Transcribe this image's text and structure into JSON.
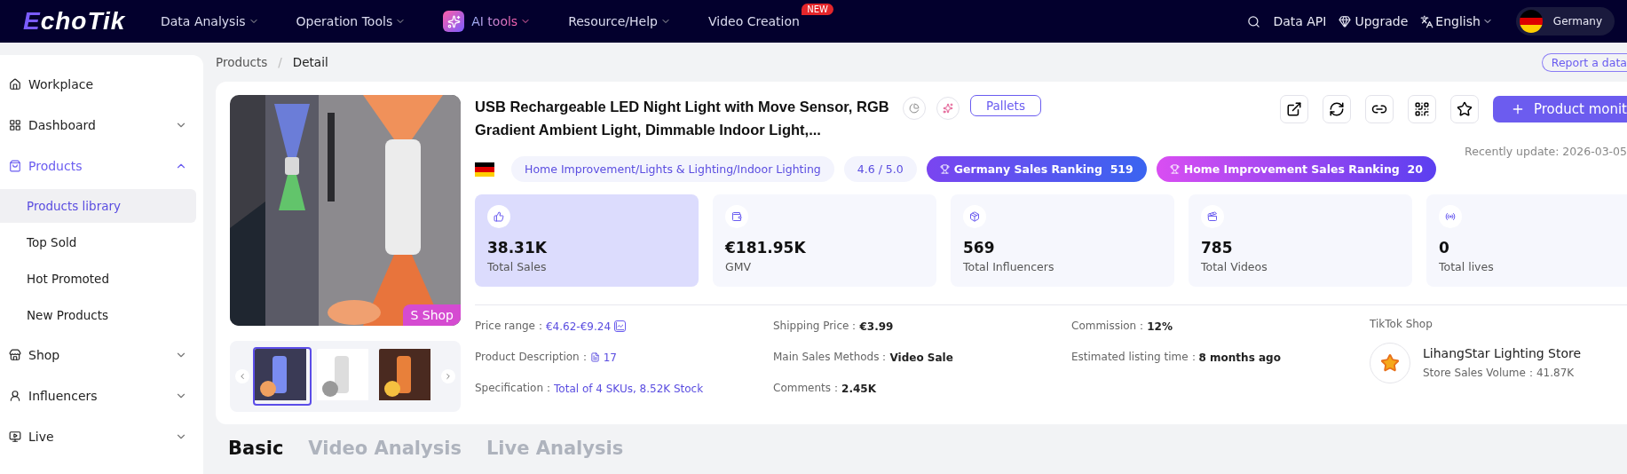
{
  "topbar": {
    "logo": "EchoTik",
    "nav": [
      {
        "label": "Data Analysis",
        "kind": "plain"
      },
      {
        "label": "Operation Tools",
        "kind": "plain"
      },
      {
        "label": "AI tools",
        "kind": "ai"
      },
      {
        "label": "Resource/Help",
        "kind": "plain"
      },
      {
        "label": "Video Creation",
        "kind": "new",
        "badge": "NEW"
      }
    ],
    "data_api": "Data API",
    "upgrade": "Upgrade",
    "language": "English",
    "country": "Germany"
  },
  "sidebar": {
    "items": [
      {
        "label": "Workplace",
        "kind": "link",
        "active": false
      },
      {
        "label": "Dashboard",
        "kind": "group",
        "expanded": false,
        "active": false
      },
      {
        "label": "Products",
        "kind": "group",
        "expanded": true,
        "active": true,
        "children": [
          {
            "label": "Products library",
            "selected": true
          },
          {
            "label": "Top Sold",
            "selected": false
          },
          {
            "label": "Hot Promoted",
            "selected": false
          },
          {
            "label": "New Products",
            "selected": false
          }
        ]
      },
      {
        "label": "Shop",
        "kind": "group",
        "expanded": false,
        "active": false
      },
      {
        "label": "Influencers",
        "kind": "group",
        "expanded": false,
        "active": false
      },
      {
        "label": "Live",
        "kind": "group",
        "expanded": false,
        "active": false
      }
    ]
  },
  "breadcrumb": {
    "items": [
      "Products",
      "Detail"
    ],
    "separator": "/"
  },
  "report": "Report a data",
  "product": {
    "title": "USB Rechargeable LED Night Light with Move Sensor, RGB Gradient Ambient Light, Dimmable Indoor Light,...",
    "tag": "Pallets",
    "category": "Home Improvement/Lights & Lighting/Indoor Lighting",
    "rating": "4.6 / 5.0",
    "rankings": [
      {
        "label": "Germany Sales Ranking",
        "value": "519",
        "kind": "blue"
      },
      {
        "label": "Home Improvement Sales Ranking",
        "value": "20",
        "kind": "pink"
      }
    ],
    "shop_badge": "S Shop",
    "monitor_button": "Product monit",
    "updated": "Recently update: 2026-03-05",
    "stats": [
      {
        "value": "38.31K",
        "label": "Total Sales",
        "selected": true
      },
      {
        "value": "€181.95K",
        "label": "GMV",
        "selected": false
      },
      {
        "value": "569",
        "label": "Total Influencers",
        "selected": false
      },
      {
        "value": "785",
        "label": "Total Videos",
        "selected": false
      },
      {
        "value": "0",
        "label": "Total lives",
        "selected": false
      }
    ],
    "details": [
      [
        {
          "label": "Price range：",
          "value": "€4.62-€9.24",
          "kind": "chart"
        },
        {
          "label": "Product Description：",
          "value": "17",
          "kind": "doc"
        },
        {
          "label": "Specification：",
          "value": "Total of 4 SKUs, 8.52K Stock",
          "kind": "link"
        }
      ],
      [
        {
          "label": "Shipping Price：",
          "value": "€3.99",
          "kind": "plain"
        },
        {
          "label": "Main Sales Methods：",
          "value": "Video Sale",
          "kind": "plain"
        },
        {
          "label": "Comments：",
          "value": "2.45K",
          "kind": "plain"
        }
      ],
      [
        {
          "label": "Commission：",
          "value": "12%",
          "kind": "plain"
        },
        {
          "label": "Estimated listing time：",
          "value": "8 months ago",
          "kind": "plain"
        }
      ]
    ],
    "shop": {
      "heading": "TikTok Shop",
      "name": "LihangStar Lighting Store",
      "volume": "Store Sales Volume：41.87K"
    }
  },
  "tabs": [
    {
      "label": "Basic",
      "selected": true
    },
    {
      "label": "Video Analysis",
      "selected": false
    },
    {
      "label": "Live Analysis",
      "selected": false
    }
  ]
}
